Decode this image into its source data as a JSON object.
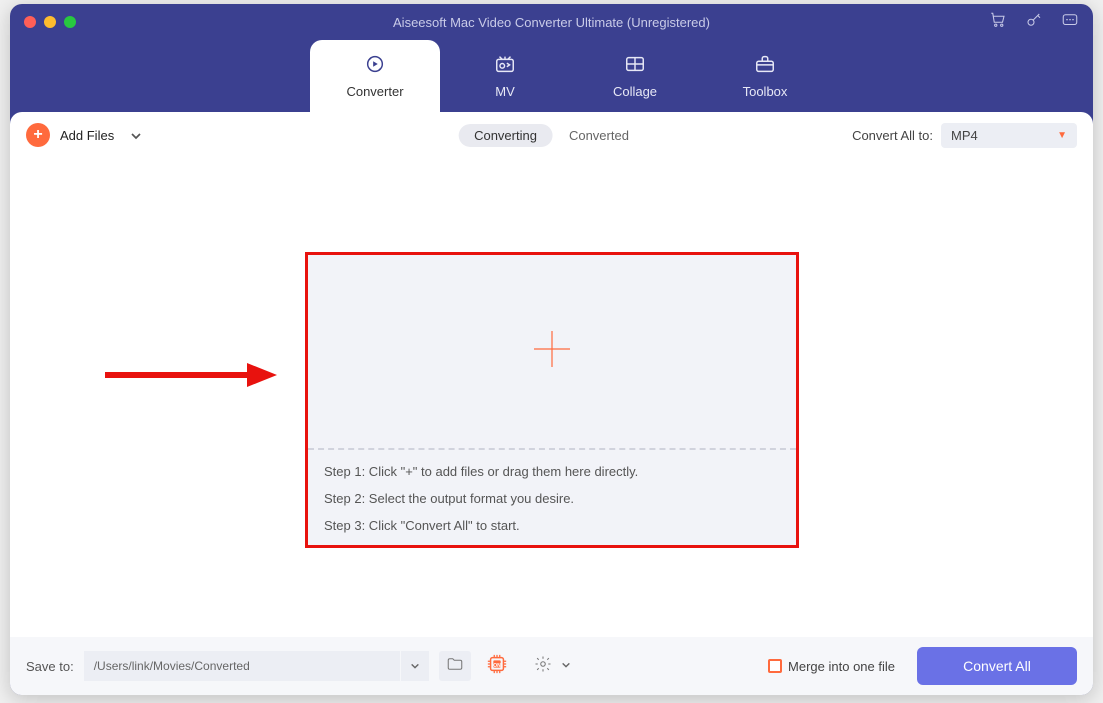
{
  "window": {
    "title": "Aiseesoft Mac Video Converter Ultimate (Unregistered)"
  },
  "tabs": [
    {
      "label": "Converter",
      "icon": "converter"
    },
    {
      "label": "MV",
      "icon": "mv"
    },
    {
      "label": "Collage",
      "icon": "collage"
    },
    {
      "label": "Toolbox",
      "icon": "toolbox"
    }
  ],
  "active_tab": 0,
  "toolbar": {
    "add_files_label": "Add Files",
    "segments": [
      "Converting",
      "Converted"
    ],
    "active_segment": 0,
    "convert_all_to_label": "Convert All to:",
    "selected_format": "MP4"
  },
  "dropzone": {
    "steps": [
      "Step 1: Click \"+\" to add files or drag them here directly.",
      "Step 2: Select the output format you desire.",
      "Step 3: Click \"Convert All\" to start."
    ]
  },
  "bottombar": {
    "save_to_label": "Save to:",
    "save_to_path": "/Users/link/Movies/Converted",
    "merge_label": "Merge into one file",
    "convert_button_label": "Convert All"
  },
  "colors": {
    "brand_accent": "#ff6a3d",
    "primary_purple": "#3b4090",
    "button_blue": "#6a71e6",
    "highlight_red": "#e8120e"
  }
}
